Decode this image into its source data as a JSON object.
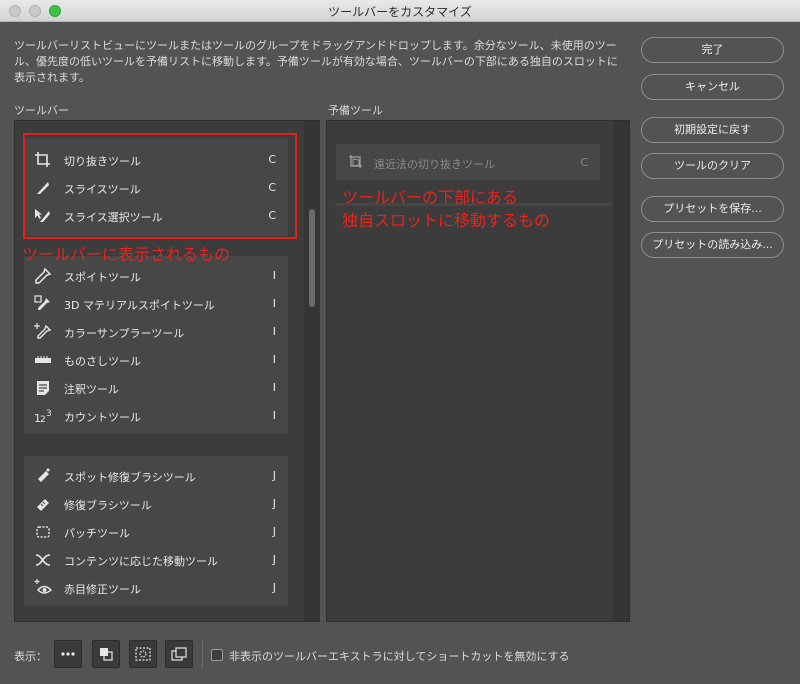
{
  "window": {
    "title": "ツールバーをカスタマイズ"
  },
  "description": "ツールバーリストビューにツールまたはツールのグループをドラッグアンドドロップします。余分なツール、未使用のツール、優先度の低いツールを予備リストに移動します。予備ツールが有効な場合、ツールバーの下部にある独自のスロットに表示されます。",
  "toolbar_label": "ツールバー",
  "extra_label": "予備ツール",
  "groups": [
    {
      "tools": [
        {
          "name": "切り抜きツール",
          "shortcut": "C",
          "icon": "crop-icon"
        },
        {
          "name": "スライスツール",
          "shortcut": "C",
          "icon": "slice-icon"
        },
        {
          "name": "スライス選択ツール",
          "shortcut": "C",
          "icon": "slice-select-icon"
        }
      ]
    },
    {
      "tools": [
        {
          "name": "スポイトツール",
          "shortcut": "I",
          "icon": "eyedropper-icon"
        },
        {
          "name": "3D マテリアルスポイトツール",
          "shortcut": "I",
          "icon": "3d-material-eyedropper-icon"
        },
        {
          "name": "カラーサンプラーツール",
          "shortcut": "I",
          "icon": "color-sampler-icon"
        },
        {
          "name": "ものさしツール",
          "shortcut": "I",
          "icon": "ruler-icon"
        },
        {
          "name": "注釈ツール",
          "shortcut": "I",
          "icon": "note-icon"
        },
        {
          "name": "カウントツール",
          "shortcut": "I",
          "icon": "count-icon"
        }
      ]
    },
    {
      "tools": [
        {
          "name": "スポット修復ブラシツール",
          "shortcut": "J",
          "icon": "spot-healing-brush-icon"
        },
        {
          "name": "修復ブラシツール",
          "shortcut": "J",
          "icon": "healing-brush-icon"
        },
        {
          "name": "パッチツール",
          "shortcut": "J",
          "icon": "patch-icon"
        },
        {
          "name": "コンテンツに応じた移動ツール",
          "shortcut": "J",
          "icon": "content-aware-move-icon"
        },
        {
          "name": "赤目修正ツール",
          "shortcut": "J",
          "icon": "red-eye-icon"
        }
      ]
    }
  ],
  "extra_tools": [
    {
      "name": "遠近法の切り抜きツール",
      "shortcut": "C",
      "icon": "perspective-crop-icon"
    }
  ],
  "annotations": {
    "toolbar": "ツールバーに表示されるもの",
    "extra_line1": "ツールバーの下部にある",
    "extra_line2": "独自スロットに移動するもの"
  },
  "buttons": {
    "done": "完了",
    "cancel": "キャンセル",
    "restore_defaults": "初期設定に戻す",
    "clear_tools": "ツールのクリア",
    "save_preset": "プリセットを保存...",
    "load_preset": "プリセットの読み込み..."
  },
  "footer": {
    "show_label": "表示：",
    "checkbox_label": "非表示のツールバーエキストラに対してショートカットを無効にする",
    "checkbox_checked": false
  },
  "colors": {
    "annotation": "#e8231e",
    "background": "#535353"
  }
}
